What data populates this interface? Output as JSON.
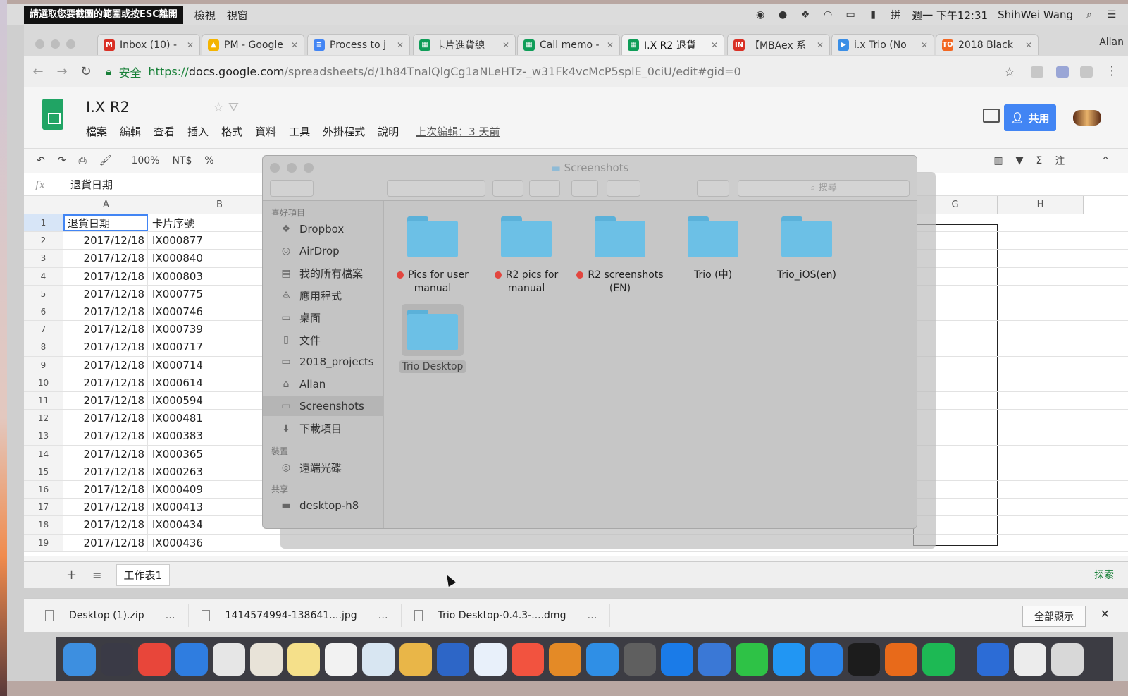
{
  "menubar": {
    "capture_hint": "請選取您要截圖的範圍或按ESC離開",
    "items": [
      "檢視",
      "視窗"
    ],
    "clock": "週一 下午12:31",
    "user": "ShihWei Wang"
  },
  "browser": {
    "tabs": [
      {
        "label": "Inbox (10) -",
        "color": "#d93025",
        "glyph": "M"
      },
      {
        "label": "PM - Google",
        "color": "#f4b400",
        "glyph": "▲"
      },
      {
        "label": "Process to j",
        "color": "#4285f4",
        "glyph": "≡"
      },
      {
        "label": "卡片進貨總",
        "color": "#0f9d58",
        "glyph": "▦"
      },
      {
        "label": "Call memo -",
        "color": "#0f9d58",
        "glyph": "▦"
      },
      {
        "label": "I.X R2 退貨",
        "color": "#0f9d58",
        "glyph": "▦"
      },
      {
        "label": "【MBAex 系",
        "color": "#d93025",
        "glyph": "IN"
      },
      {
        "label": "i.x Trio (No",
        "color": "#3a8ee6",
        "glyph": "▶"
      },
      {
        "label": "2018 Black",
        "color": "#f26722",
        "glyph": "TO"
      }
    ],
    "profile": "Allan",
    "url_secure": "安全",
    "url_scheme": "https://",
    "url_host": "docs.google.com",
    "url_path": "/spreadsheets/d/1h84TnalQlgCg1aNLeHTz-_w31Fk4vcMcP5splE_0ciU/edit#gid=0"
  },
  "sheets": {
    "title": "I.X R2",
    "menus": [
      "檔案",
      "編輯",
      "查看",
      "插入",
      "格式",
      "資料",
      "工具",
      "外掛程式",
      "說明"
    ],
    "last_edit": "上次編輯：3 天前",
    "share_label": "共用",
    "zoom": "100%",
    "currency": "NT$",
    "percent": "%",
    "formula_label": "fx",
    "formula_value": "退貨日期",
    "columns": [
      "A",
      "B",
      "G",
      "H"
    ],
    "header_row": {
      "a": "退貨日期",
      "b": "卡片序號"
    },
    "rows": [
      {
        "n": "2",
        "date": "2017/12/18",
        "id": "IX000877"
      },
      {
        "n": "3",
        "date": "2017/12/18",
        "id": "IX000840"
      },
      {
        "n": "4",
        "date": "2017/12/18",
        "id": "IX000803"
      },
      {
        "n": "5",
        "date": "2017/12/18",
        "id": "IX000775"
      },
      {
        "n": "6",
        "date": "2017/12/18",
        "id": "IX000746"
      },
      {
        "n": "7",
        "date": "2017/12/18",
        "id": "IX000739"
      },
      {
        "n": "8",
        "date": "2017/12/18",
        "id": "IX000717"
      },
      {
        "n": "9",
        "date": "2017/12/18",
        "id": "IX000714"
      },
      {
        "n": "10",
        "date": "2017/12/18",
        "id": "IX000614"
      },
      {
        "n": "11",
        "date": "2017/12/18",
        "id": "IX000594"
      },
      {
        "n": "12",
        "date": "2017/12/18",
        "id": "IX000481"
      },
      {
        "n": "13",
        "date": "2017/12/18",
        "id": "IX000383"
      },
      {
        "n": "14",
        "date": "2017/12/18",
        "id": "IX000365"
      },
      {
        "n": "15",
        "date": "2017/12/18",
        "id": "IX000263"
      },
      {
        "n": "16",
        "date": "2017/12/18",
        "id": "IX000409"
      },
      {
        "n": "17",
        "date": "2017/12/18",
        "id": "IX000413"
      },
      {
        "n": "18",
        "date": "2017/12/18",
        "id": "IX000434"
      },
      {
        "n": "19",
        "date": "2017/12/18",
        "id": "IX000436"
      }
    ],
    "sheet_tab": "工作表1",
    "explore_label": "探索"
  },
  "finder": {
    "title": "Screenshots",
    "search_placeholder": "搜尋",
    "sidebar": {
      "favorites_label": "喜好項目",
      "favorites": [
        "Dropbox",
        "AirDrop",
        "我的所有檔案",
        "應用程式",
        "桌面",
        "文件",
        "2018_projects",
        "Allan",
        "Screenshots",
        "下載項目"
      ],
      "devices_label": "裝置",
      "devices": [
        "遠端光碟"
      ],
      "shared_label": "共享",
      "shared": [
        "desktop-h8"
      ]
    },
    "folders": [
      {
        "name": "Pics for user manual",
        "tagged": true
      },
      {
        "name": "R2 pics for manual",
        "tagged": true
      },
      {
        "name": "R2 screenshots (EN)",
        "tagged": true
      },
      {
        "name": "Trio (中)",
        "tagged": false
      },
      {
        "name": "Trio_iOS(en)",
        "tagged": false
      },
      {
        "name": "Trio Desktop",
        "tagged": false
      }
    ]
  },
  "downloads": {
    "items": [
      "Desktop (1).zip",
      "1414574994-138641....jpg",
      "Trio Desktop-0.4.3-....dmg"
    ],
    "more": "…",
    "show_all": "全部顯示"
  }
}
